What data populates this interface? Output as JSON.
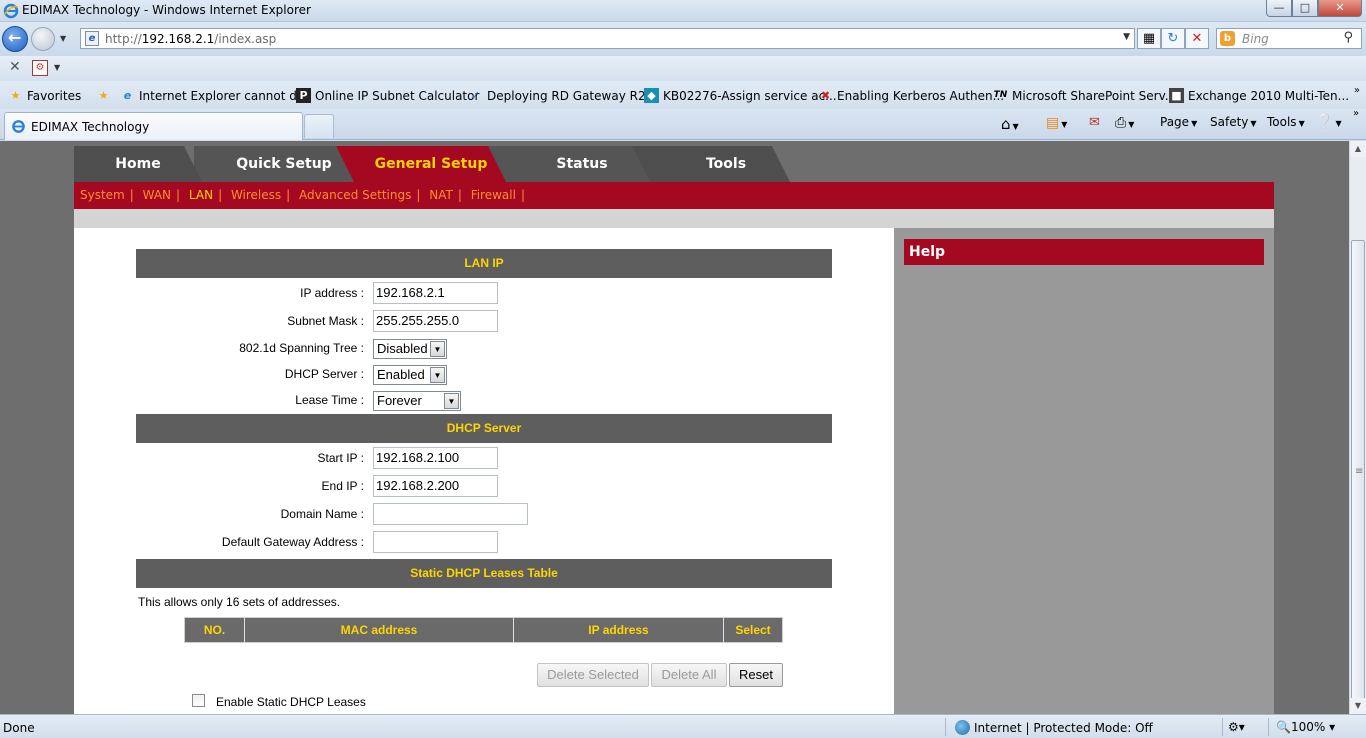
{
  "window": {
    "title": "EDIMAX Technology - Windows Internet Explorer",
    "buttons": {
      "minimize": "—",
      "maximize": "□",
      "close": "✕"
    }
  },
  "address_bar": {
    "url_prefix": "http://",
    "url_host": "192.168.2.1",
    "url_path": "/index.asp",
    "search_placeholder": "Bing"
  },
  "favorites_bar": {
    "favorites_label": "Favorites",
    "items": [
      "Internet Explorer cannot d...",
      "Online IP Subnet Calculator",
      "Deploying RD Gateway R2...",
      "KB02276-Assign service ac...",
      "Enabling Kerberos Authen...",
      "Microsoft SharePoint Serv...",
      "Exchange 2010 Multi-Ten..."
    ]
  },
  "tab": {
    "title": "EDIMAX Technology"
  },
  "command_bar": {
    "page": "Page",
    "safety": "Safety",
    "tools": "Tools"
  },
  "router": {
    "main_tabs": [
      "Home",
      "Quick Setup",
      "General Setup",
      "Status",
      "Tools"
    ],
    "active_tab": "General Setup",
    "sub_nav": [
      "System",
      "WAN",
      "LAN",
      "Wireless",
      "Advanced Settings",
      "NAT",
      "Firewall"
    ],
    "active_sub": "LAN",
    "lan_ip": {
      "heading": "LAN IP",
      "ip_label": "IP address :",
      "ip_value": "192.168.2.1",
      "mask_label": "Subnet Mask :",
      "mask_value": "255.255.255.0",
      "stp_label": "802.1d Spanning Tree :",
      "stp_value": "Disabled",
      "dhcp_label": "DHCP Server :",
      "dhcp_value": "Enabled",
      "lease_label": "Lease Time :",
      "lease_value": "Forever"
    },
    "dhcp_server": {
      "heading": "DHCP Server",
      "start_label": "Start IP :",
      "start_value": "192.168.2.100",
      "end_label": "End IP :",
      "end_value": "192.168.2.200",
      "domain_label": "Domain Name :",
      "domain_value": "",
      "gateway_label": "Default Gateway Address :",
      "gateway_value": ""
    },
    "static_leases": {
      "heading": "Static DHCP Leases Table",
      "note": "This allows only 16 sets of addresses.",
      "columns": [
        "NO.",
        "MAC address",
        "IP address",
        "Select"
      ],
      "delete_selected": "Delete Selected",
      "delete_all": "Delete All",
      "reset": "Reset",
      "enable_label": "Enable Static DHCP Leases"
    },
    "help": {
      "heading": "Help"
    }
  },
  "status_bar": {
    "status": "Done",
    "zone": "Internet | Protected Mode: Off",
    "zoom": "100%"
  },
  "colors": {
    "router_red": "#a50821",
    "router_tab_grey": "#4e4e4e",
    "router_yellow": "#ffd500",
    "router_orange_link": "#ff8f2e"
  }
}
